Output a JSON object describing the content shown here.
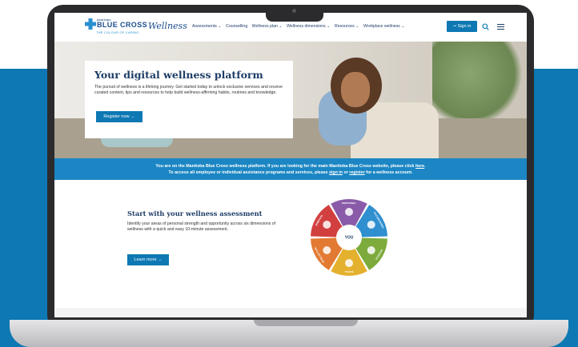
{
  "header": {
    "brand_small": "MANITOBA",
    "brand_name": "BLUE CROSS",
    "brand_tagline": "THE COLOUR OF CARING",
    "wellness_label": "Wellness",
    "nav": [
      "Assessments ⌄",
      "Counselling",
      "Wellness plan ⌄",
      "Wellness dimensions ⌄",
      "Resources ⌄",
      "Workplace wellness ⌄"
    ],
    "signin_label": "Sign in"
  },
  "hero": {
    "title": "Your digital wellness platform",
    "text": "The pursuit of wellness is a lifelong journey. Get started today to unlock exclusive services and receive curated content, tips and resources to help build wellness-affirming habits, routines and knowledge.",
    "button_label": "Register now →"
  },
  "notice": {
    "line1_pre": "You are on the Manitoba Blue Cross wellness platform. If you are looking for the main Manitoba Blue Cross website, please click ",
    "line1_link": "here",
    "line1_post": ".",
    "line2_pre": "To access all employee or individual assistance programs and services, please ",
    "line2_link1": "sign in",
    "line2_mid": " or ",
    "line2_link2": "register",
    "line2_post": " for a wellness account."
  },
  "assessment": {
    "title": "Start with your wellness assessment",
    "text": "Identify your areas of personal strength and opportunity across six dimensions of wellness with a quick and easy 10-minute assessment.",
    "button_label": "Learn more →"
  },
  "wheel": {
    "center_label": "YOU",
    "segments": [
      {
        "label": "EMOTIONAL",
        "color": "#8a5ba8"
      },
      {
        "label": "OCCUPATIONAL",
        "color": "#2f8fcf"
      },
      {
        "label": "PHYSICAL",
        "color": "#7dab3c"
      },
      {
        "label": "SOCIAL",
        "color": "#e4b12e"
      },
      {
        "label": "INTELLECTUAL",
        "color": "#e27a33"
      },
      {
        "label": "SPIRITUAL",
        "color": "#d1403f"
      }
    ]
  },
  "colors": {
    "primary": "#0d78b3",
    "navy": "#1d3d66",
    "notice": "#1b86c3"
  }
}
